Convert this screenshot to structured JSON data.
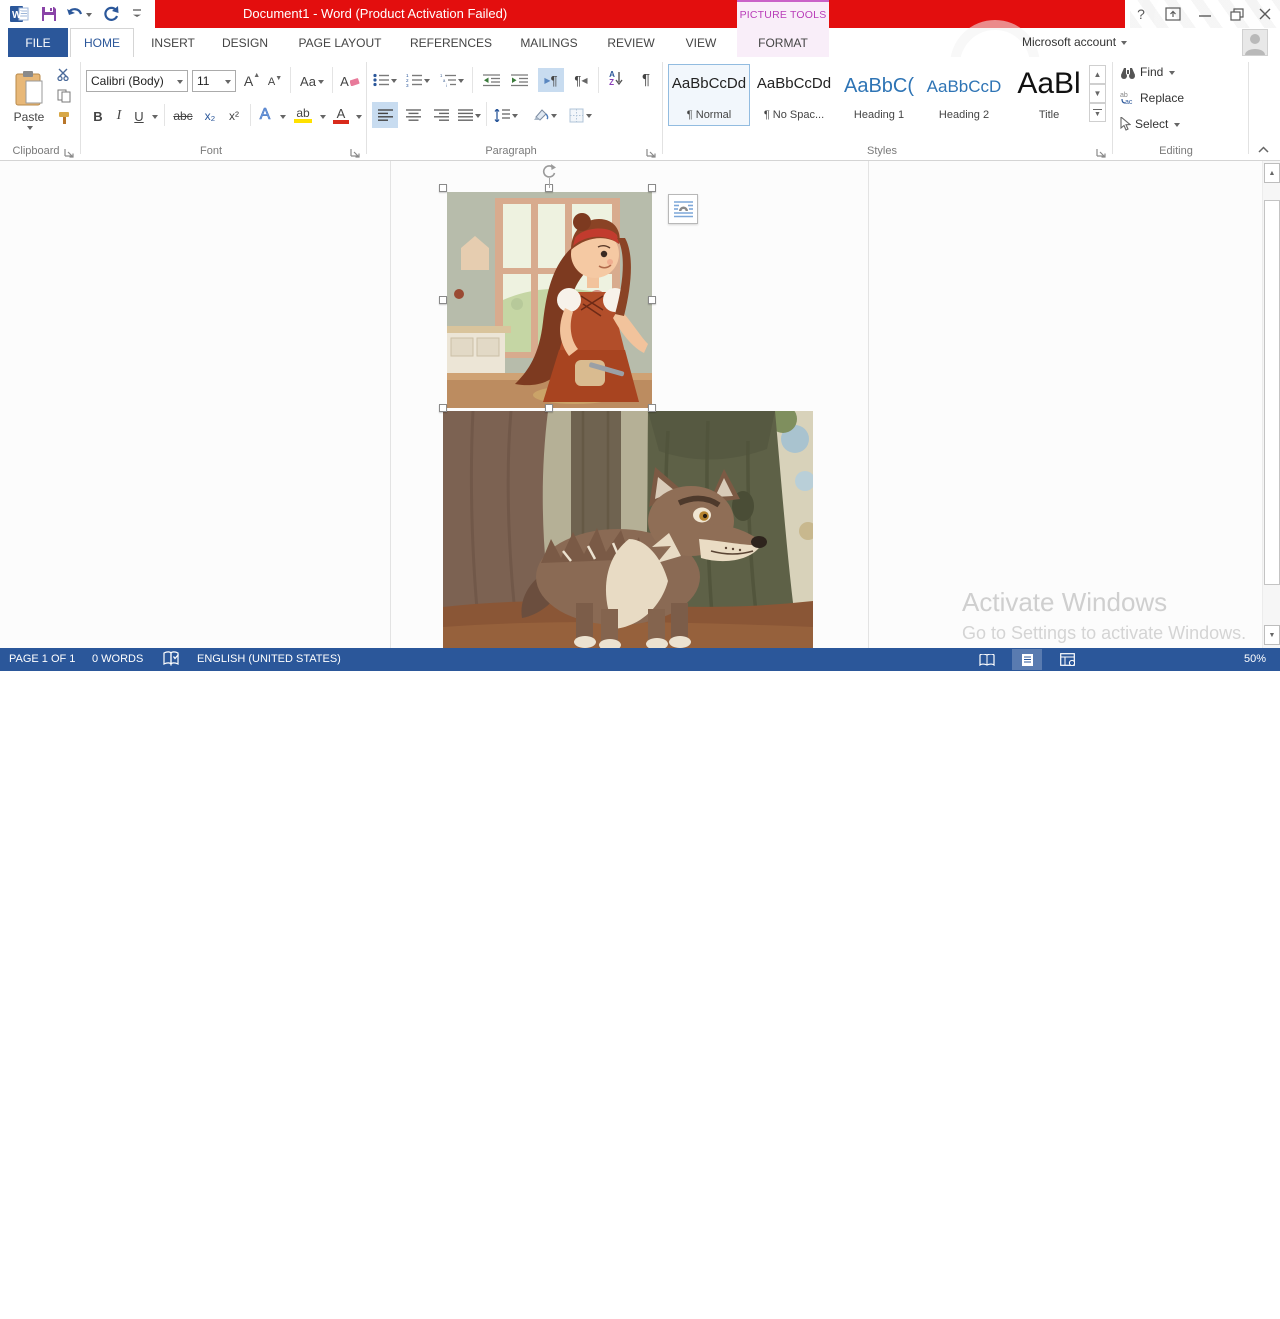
{
  "titlebar": {
    "title": "Document1 -  Word (Product Activation Failed)",
    "contextual_header": "PICTURE TOOLS",
    "help": "?",
    "account_label": "Microsoft account"
  },
  "tabs": {
    "file": "FILE",
    "home": "HOME",
    "insert": "INSERT",
    "design": "DESIGN",
    "page_layout": "PAGE LAYOUT",
    "references": "REFERENCES",
    "mailings": "MAILINGS",
    "review": "REVIEW",
    "view": "VIEW",
    "format": "FORMAT"
  },
  "ribbon": {
    "clipboard": {
      "label": "Clipboard",
      "paste": "Paste"
    },
    "font": {
      "label": "Font",
      "name": "Calibri (Body)",
      "size": "11",
      "grow": "A",
      "shrink": "A",
      "case": "Aa",
      "clear": "A",
      "bold": "B",
      "italic": "I",
      "underline": "U",
      "strike": "abc",
      "subscript": "x₂",
      "superscript": "x²",
      "effects": "A",
      "highlight": "ab",
      "color": "A"
    },
    "paragraph": {
      "label": "Paragraph",
      "sort_a": "A",
      "sort_z": "Z",
      "pilcrow": "¶",
      "dir_pilcrow": "¶"
    },
    "styles": {
      "label": "Styles",
      "items": [
        {
          "preview": "AaBbCcDd",
          "name": "¶ Normal"
        },
        {
          "preview": "AaBbCcDd",
          "name": "¶ No Spac..."
        },
        {
          "preview": "AaBbC(",
          "name": "Heading 1"
        },
        {
          "preview": "AaBbCcD",
          "name": "Heading 2"
        },
        {
          "preview": "AaBl",
          "name": "Title"
        }
      ]
    },
    "editing": {
      "label": "Editing",
      "find": "Find",
      "replace": "Replace",
      "select": "Select"
    }
  },
  "statusbar": {
    "page": "PAGE 1 OF 1",
    "words": "0 WORDS",
    "language": "ENGLISH (UNITED STATES)",
    "zoom": "50%"
  },
  "watermark": {
    "line1": "Activate Windows",
    "line2": "Go to Settings to activate Windows."
  },
  "colors": {
    "accent_blue": "#2b579a",
    "activation_red": "#e30e0e",
    "picture_tools_magenta": "#b93db9",
    "selection_blue": "#c8dcf0",
    "heading_blue": "#2e74b5"
  }
}
